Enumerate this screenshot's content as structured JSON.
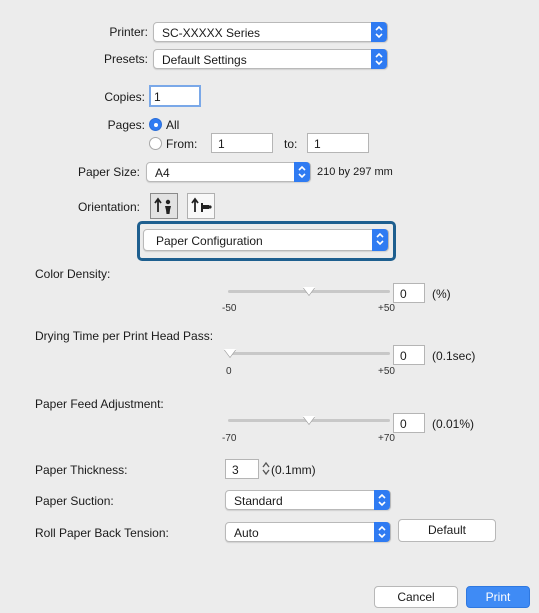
{
  "printer": {
    "label": "Printer:",
    "value": "SC-XXXXX Series"
  },
  "presets": {
    "label": "Presets:",
    "value": "Default Settings"
  },
  "copies": {
    "label": "Copies:",
    "value": "1"
  },
  "pages": {
    "label": "Pages:",
    "all": "All",
    "from_label": "From:",
    "from_value": "1",
    "to_label": "to:",
    "to_value": "1",
    "selected": "All"
  },
  "paper_size": {
    "label": "Paper Size:",
    "value": "A4",
    "dimensions": "210 by 297 mm"
  },
  "orientation": {
    "label": "Orientation:",
    "options": [
      "portrait-icon",
      "landscape-icon"
    ],
    "selected": "portrait"
  },
  "section": {
    "value": "Paper Configuration"
  },
  "color_density": {
    "label": "Color Density:",
    "value": "0",
    "unit": "(%)",
    "min": "-50",
    "max": "+50"
  },
  "drying_time": {
    "label": "Drying Time per Print Head Pass:",
    "value": "0",
    "unit": "(0.1sec)",
    "min": "0",
    "max": "+50"
  },
  "paper_feed": {
    "label": "Paper Feed Adjustment:",
    "value": "0",
    "unit": "(0.01%)",
    "min": "-70",
    "max": "+70"
  },
  "paper_thickness": {
    "label": "Paper Thickness:",
    "value": "3",
    "unit": "(0.1mm)"
  },
  "paper_suction": {
    "label": "Paper Suction:",
    "value": "Standard"
  },
  "roll_tension": {
    "label": "Roll Paper Back Tension:",
    "value": "Auto",
    "default_label": "Default"
  },
  "footer": {
    "cancel": "Cancel",
    "print": "Print"
  },
  "colors": {
    "accent": "#2f7bf2",
    "highlight_border": "#1e5f8f",
    "background": "#ececec"
  }
}
